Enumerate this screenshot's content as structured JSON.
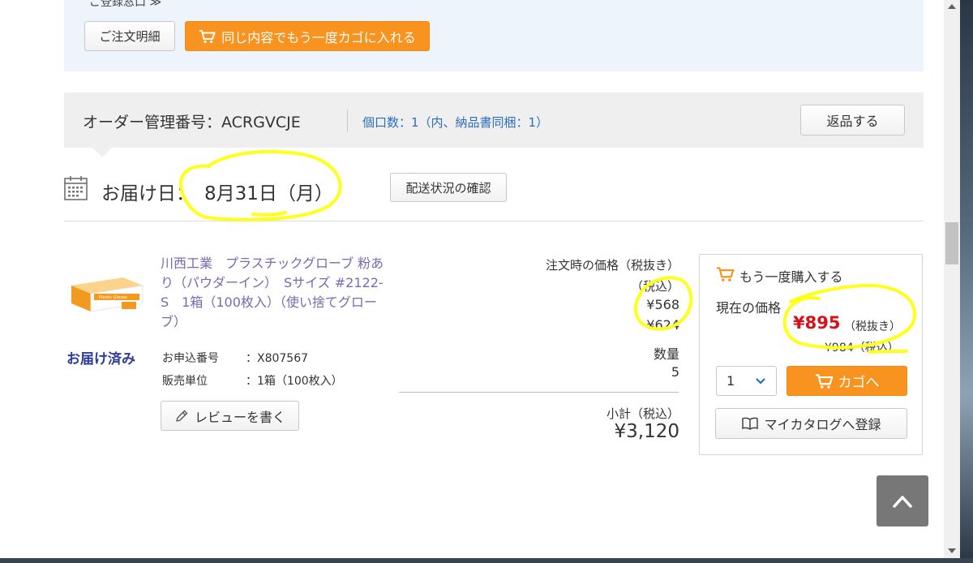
{
  "top_panel": {
    "partial_text": "ご登録窓口 ≫",
    "order_detail_button": "ご注文明細",
    "reorder_button": "同じ内容でもう一度カゴに入れる"
  },
  "order": {
    "number": "オーダー管理番号：ACRGVCJE",
    "packages": "個口数：1（内、納品書同梱：1）",
    "return_button": "返品する"
  },
  "delivery": {
    "label": "お届け日：",
    "date": "8月31日（月）",
    "tracking_button": "配送状況の確認"
  },
  "product": {
    "name": "川西工業　プラスチックグローブ 粉あり（パウダーイン）　Sサイズ #2122-S　1箱（100枚入）（使い捨てグローブ）",
    "image_label": "Plastic Gloves",
    "status": "お届け済み",
    "application_label": "お申込番号",
    "application_value": "：X807567",
    "unit_label": "販売単位",
    "unit_value": "：1箱（100枚入）",
    "review_button": "レビューを書く"
  },
  "pricing": {
    "price_label": "注文時の価格（税抜き）",
    "tax_in_label": "（税込）",
    "price_ex_tax": "¥568",
    "price_in_tax": "¥624",
    "quantity_label": "数量",
    "quantity_value": "5",
    "subtotal_label": "小計（税込）",
    "subtotal_value": "¥3,120"
  },
  "rebuy": {
    "title": "もう一度購入する",
    "current_price_label": "現在の価格",
    "current_price": "¥895",
    "current_price_suffix": "（税抜き）",
    "current_price_in_tax": "¥984（税込）",
    "quantity_selected": "1",
    "cart_button": "カゴへ",
    "catalog_button": "マイカタログへ登録"
  },
  "colors": {
    "accent_orange": "#f7931e",
    "price_red": "#d7111a",
    "link_blue": "#2a6ebb",
    "highlighter_yellow": "#ffff1a"
  },
  "icons": [
    "cart-icon",
    "calendar-icon",
    "pencil-icon",
    "book-icon",
    "chevron-down-icon",
    "chevron-up-icon"
  ]
}
